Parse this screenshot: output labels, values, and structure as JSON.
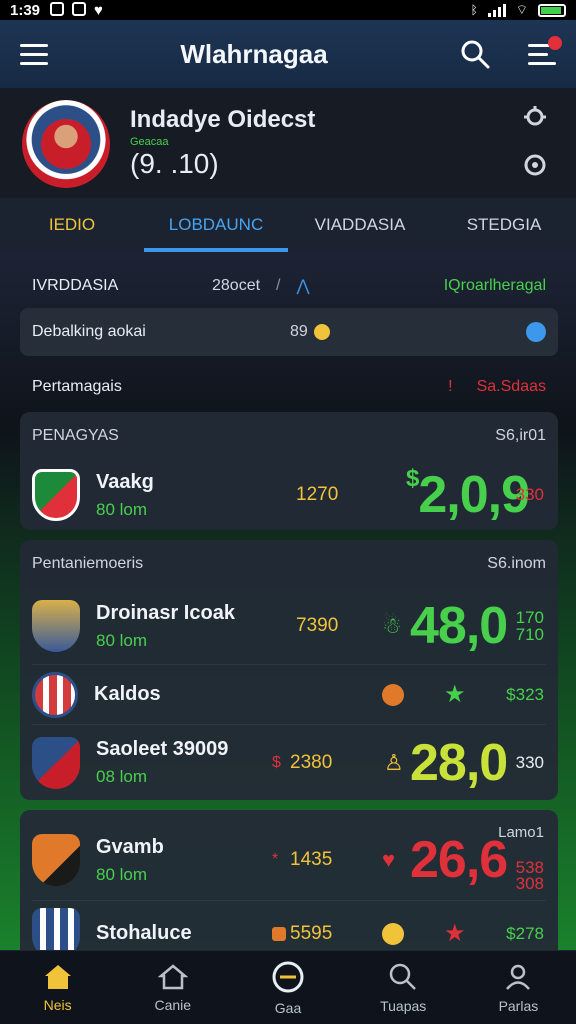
{
  "status_bar": {
    "time": "1:39"
  },
  "app_bar": {
    "title": "Wlahrnagaa"
  },
  "profile": {
    "name": "Indadye Oidecst",
    "subtitle": "Geacaa",
    "value": "(9. .10)"
  },
  "tabs": [
    {
      "label": "IEDIO",
      "active": false
    },
    {
      "label": "LOBDAUNC",
      "active": true
    },
    {
      "label": "VIADDASIA",
      "active": false
    },
    {
      "label": "STEDGIA",
      "active": false
    }
  ],
  "filter_row": {
    "left": "IVRDDASIA",
    "middle": "28ocet",
    "sep": "/",
    "right": "IQroarlheragal"
  },
  "search_row": {
    "label": "Debalking aokai",
    "count": "89"
  },
  "section": {
    "label": "Pertamagais",
    "right": "Sa.Sdaas"
  },
  "cards": [
    {
      "title": "PENAGYAS",
      "right": "S6,ir01",
      "teams": [
        {
          "name": "Vaakg",
          "time": "80 lom",
          "odd": "1270",
          "big": "2,0,9",
          "big_prefix": "$",
          "side": "330",
          "side_color": "#e0303a",
          "crest_colors": [
            "#1d8a3a",
            "#e0303a"
          ]
        }
      ]
    },
    {
      "title": "Pentaniemoeris",
      "right": "S6.inom",
      "teams": [
        {
          "name": "Droinasr Icoak",
          "time": "80 lom",
          "odd": "7390",
          "big": "48,0",
          "big_prefix": "",
          "side": "170\n710",
          "side_color": "#48d04d",
          "crest_colors": [
            "#d8b04a",
            "#3a5a9a"
          ]
        },
        {
          "name": "Kaldos",
          "time": "",
          "odd": "",
          "big": "",
          "big_prefix": "",
          "side": "$323",
          "side_color": "#48d04d",
          "crest_colors": [
            "#d23c3c",
            "#2d4f88"
          ]
        },
        {
          "name": "Saoleet 39009",
          "time": "08 lom",
          "odd": "2380",
          "big": "28,0",
          "big_prefix": "",
          "side": "330",
          "side_color": "#e8edf4",
          "crest_colors": [
            "#2d4f88",
            "#c81e2a"
          ]
        }
      ]
    },
    {
      "title": "",
      "right": "Lamo1",
      "teams": [
        {
          "name": "Gvamb",
          "time": "80 lom",
          "odd": "1435",
          "big": "26,6",
          "big_prefix": "",
          "side": "538\n308",
          "side_color": "#e0303a",
          "crest_colors": [
            "#e07a2a",
            "#1a1a1a"
          ]
        },
        {
          "name": "Stohaluce",
          "time": "",
          "odd": "5595",
          "big": "",
          "big_prefix": "",
          "side": "$278",
          "side_color": "#48d04d",
          "crest_colors": [
            "#2d4f88",
            "#ffffff"
          ]
        }
      ]
    }
  ],
  "bottom_nav": [
    {
      "label": "Neis",
      "icon": "home-icon",
      "active": true
    },
    {
      "label": "Canie",
      "icon": "house-outline-icon",
      "active": false
    },
    {
      "label": "Gaa",
      "icon": "circle-minus-icon",
      "active": false
    },
    {
      "label": "Tuapas",
      "icon": "search-icon",
      "active": false
    },
    {
      "label": "Parlas",
      "icon": "person-icon",
      "active": false
    }
  ],
  "colors": {
    "accent": "#3d97ea",
    "gold": "#f0c33a",
    "green": "#48d04d",
    "red": "#e0303a"
  }
}
